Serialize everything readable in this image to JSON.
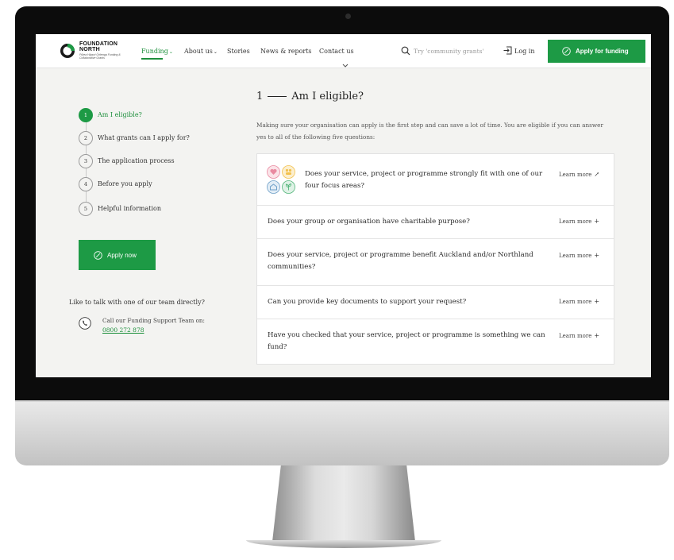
{
  "nav": {
    "logo_name_line1": "FOUNDATION",
    "logo_name_line2": "NORTH",
    "logo_subtext": "Pūtea Hāpori Ōritenga Funding & Collaborative Grants",
    "links": [
      {
        "label": "Funding",
        "caret": "⌄"
      },
      {
        "label": "About us",
        "caret": "⌄"
      },
      {
        "label": "Stories"
      },
      {
        "label": "News & reports"
      },
      {
        "label": "Contact us"
      }
    ],
    "search_placeholder": "Try 'community grants'",
    "login_label": "Log in",
    "apply_label": "Apply for funding",
    "colors": {
      "brand_green": "#1d9a45",
      "active_green": "#1d8f3c"
    }
  },
  "steps": [
    {
      "num": "1",
      "label": "Am I eligible?"
    },
    {
      "num": "2",
      "label": "What grants can I apply for?"
    },
    {
      "num": "3",
      "label": "The application process"
    },
    {
      "num": "4",
      "label": "Before you apply"
    },
    {
      "num": "5",
      "label": "Helpful information"
    }
  ],
  "sidebar": {
    "apply_now_label": "Apply now",
    "talk_heading": "Like to talk with one of our team directly?",
    "call_text": "Call our Funding Support Team on:",
    "phone_number": "0800 272 878"
  },
  "main": {
    "section_num": "1",
    "section_title": "Am I eligible?",
    "intro": "Making sure your organisation can apply is the first step and can save a lot of time. You are eligible if you can answer yes to all of the following five questions:",
    "questions": [
      {
        "text": "Does your service, project or programme strongly fit with one of our four focus areas?",
        "link": "Learn more",
        "icon": "external-link-icon"
      },
      {
        "text": "Does your group or organisation have charitable purpose?",
        "link": "Learn more",
        "icon": "plus-icon"
      },
      {
        "text": "Does your service, project or programme benefit Auckland and/or Northland communities?",
        "link": "Learn more",
        "icon": "plus-icon"
      },
      {
        "text": "Can you provide key documents to support your request?",
        "link": "Learn more",
        "icon": "plus-icon"
      },
      {
        "text": "Have you checked that your service, project or programme is something we can fund?",
        "link": "Learn more",
        "icon": "plus-icon"
      }
    ],
    "focus_icon_colors": [
      "#e98aa0",
      "#f2c14e",
      "#6fa0c8",
      "#53b57a"
    ]
  }
}
